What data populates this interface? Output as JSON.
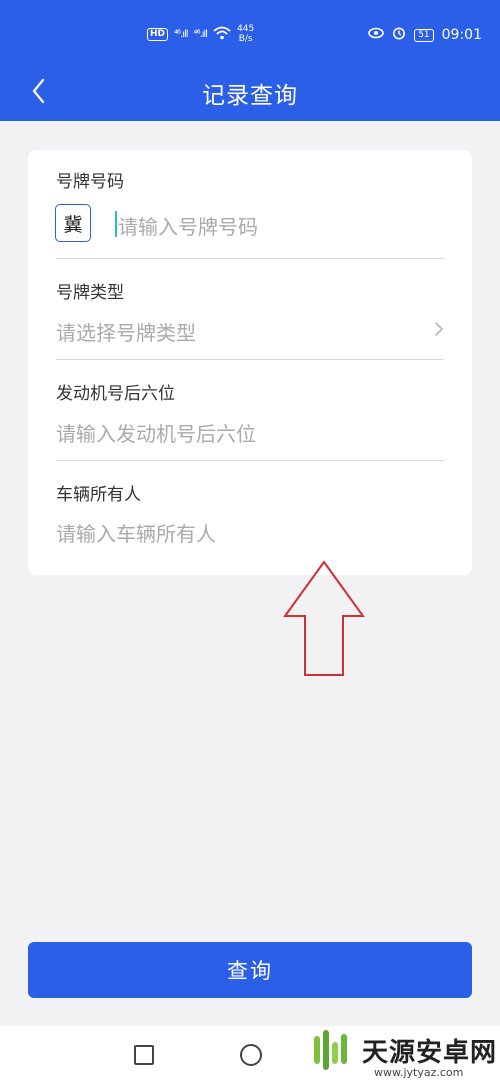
{
  "status_bar": {
    "left_badge": "HD",
    "signal_1": "⁴⁶.ıll",
    "signal_2": "⁴⁶.ıll",
    "speed_value": "445",
    "speed_unit": "B/s",
    "battery": "51",
    "time": "09:01"
  },
  "header": {
    "title": "记录查询"
  },
  "form": {
    "plate_number": {
      "label": "号牌号码",
      "province": "冀",
      "placeholder": "请输入号牌号码"
    },
    "plate_type": {
      "label": "号牌类型",
      "placeholder": "请选择号牌类型"
    },
    "engine_number": {
      "label": "发动机号后六位",
      "placeholder": "请输入发动机号后六位"
    },
    "owner": {
      "label": "车辆所有人",
      "placeholder": "请输入车辆所有人"
    }
  },
  "query_button": {
    "label": "查询"
  },
  "watermark": {
    "name": "天源安卓网",
    "url": "www.jytyaz.com"
  },
  "colors": {
    "accent": "#2c5fe8",
    "annotation_arrow": "#d03030",
    "background": "#f2f2f4"
  }
}
